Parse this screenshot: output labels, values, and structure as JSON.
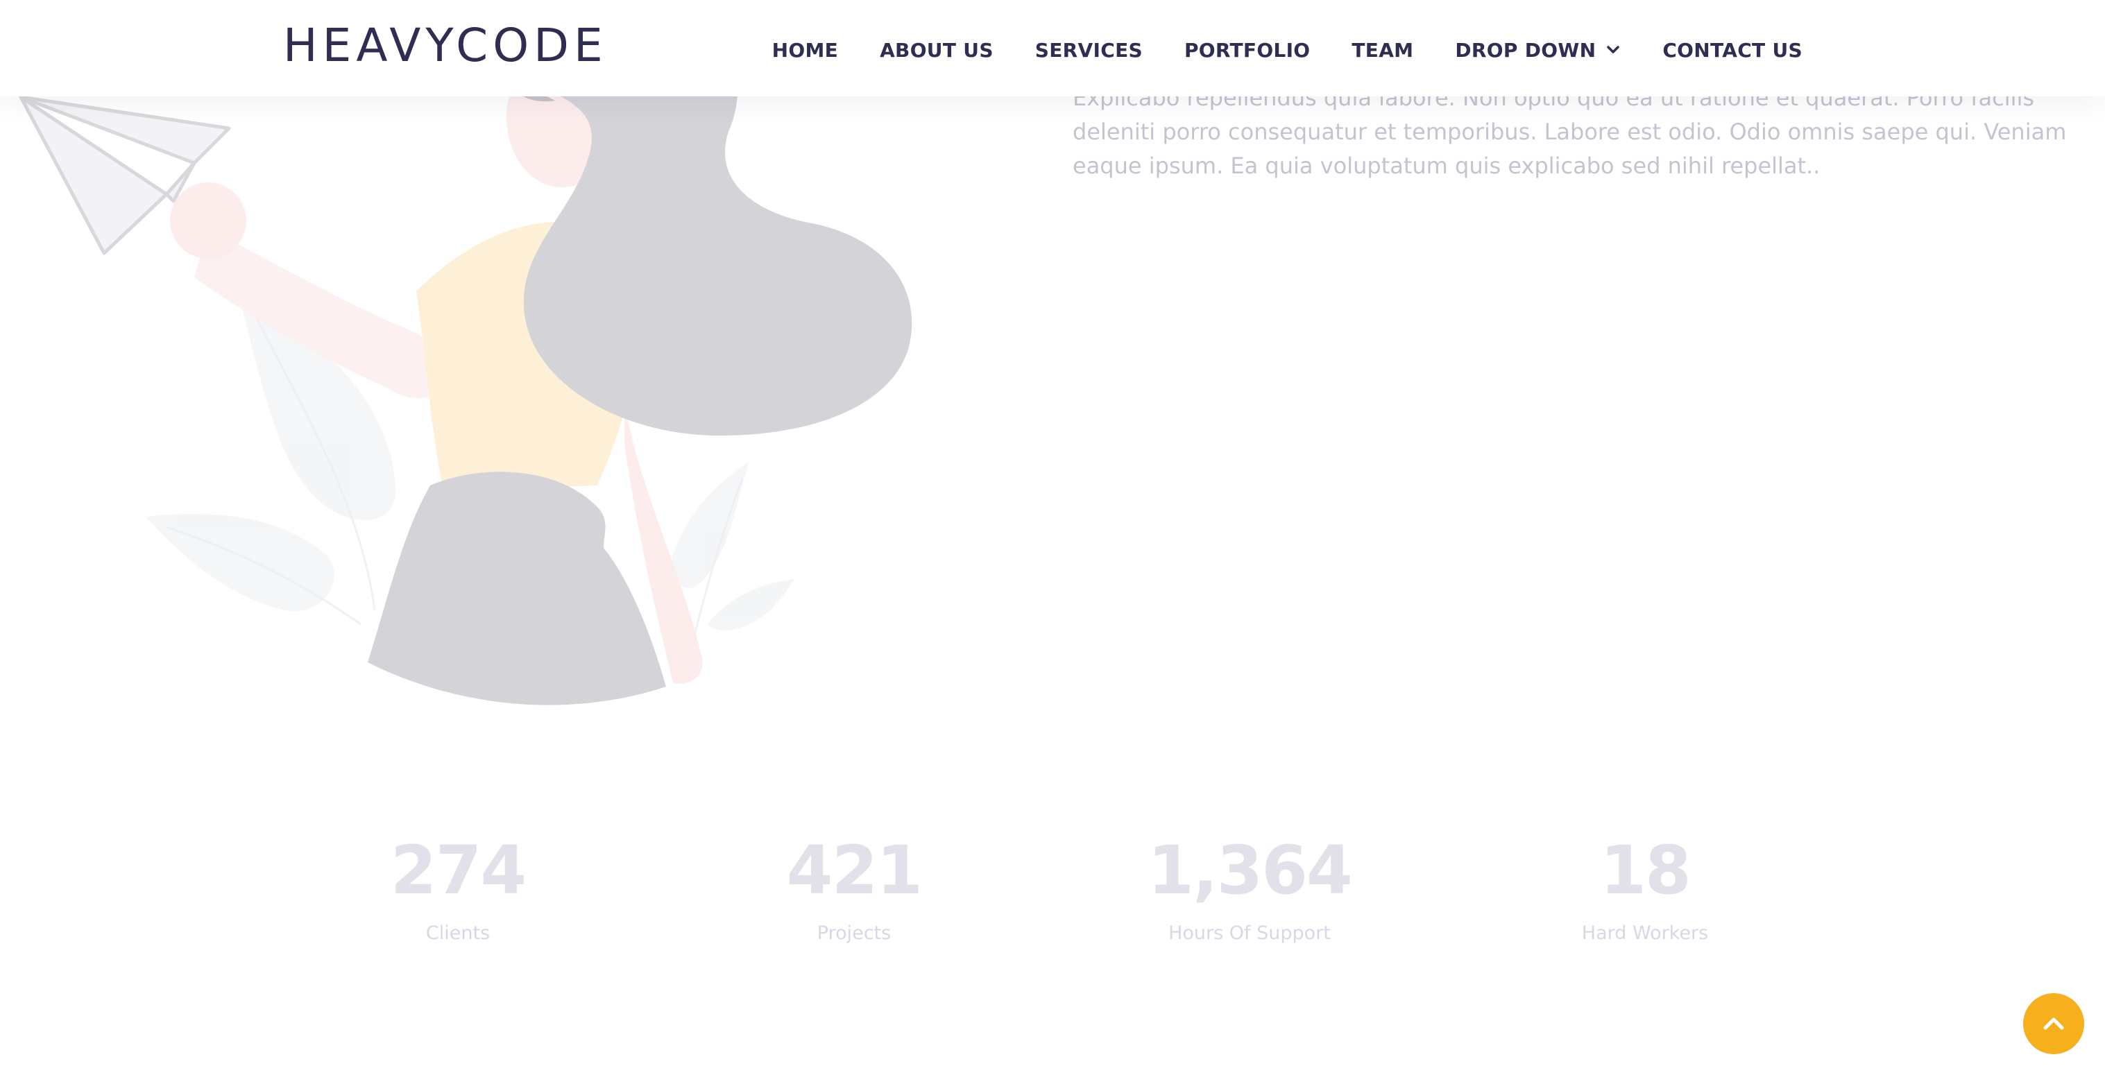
{
  "header": {
    "logo": "HEAVYCODE",
    "nav": [
      {
        "label": "HOME"
      },
      {
        "label": "ABOUT US"
      },
      {
        "label": "SERVICES"
      },
      {
        "label": "PORTFOLIO"
      },
      {
        "label": "TEAM"
      },
      {
        "label": "DROP DOWN",
        "icon": "chevron-down-icon"
      },
      {
        "label": "CONTACT US"
      }
    ]
  },
  "hero": {
    "paragraph": "Explicabo repellendus quia labore. Non optio quo ea ut ratione et quaerat. Porro facilis deleniti porro consequatur et temporibus. Labore est odio. Odio omnis saepe qui. Veniam eaque ipsum. Ea quia voluptatum quis explicabo sed nihil repellat..",
    "illustration": "woman-with-paper-plane-illustration"
  },
  "counters": [
    {
      "value": "274",
      "label": "Clients"
    },
    {
      "value": "421",
      "label": "Projects"
    },
    {
      "value": "1,364",
      "label": "Hours Of Support"
    },
    {
      "value": "18",
      "label": "Hard Workers"
    }
  ],
  "back_to_top": {
    "icon": "chevron-up-icon"
  },
  "colors": {
    "brand": "#2f2d52",
    "accent": "#f6b01e",
    "muted_text": "#c5c3cf",
    "counter_number": "#e2e1ea"
  }
}
